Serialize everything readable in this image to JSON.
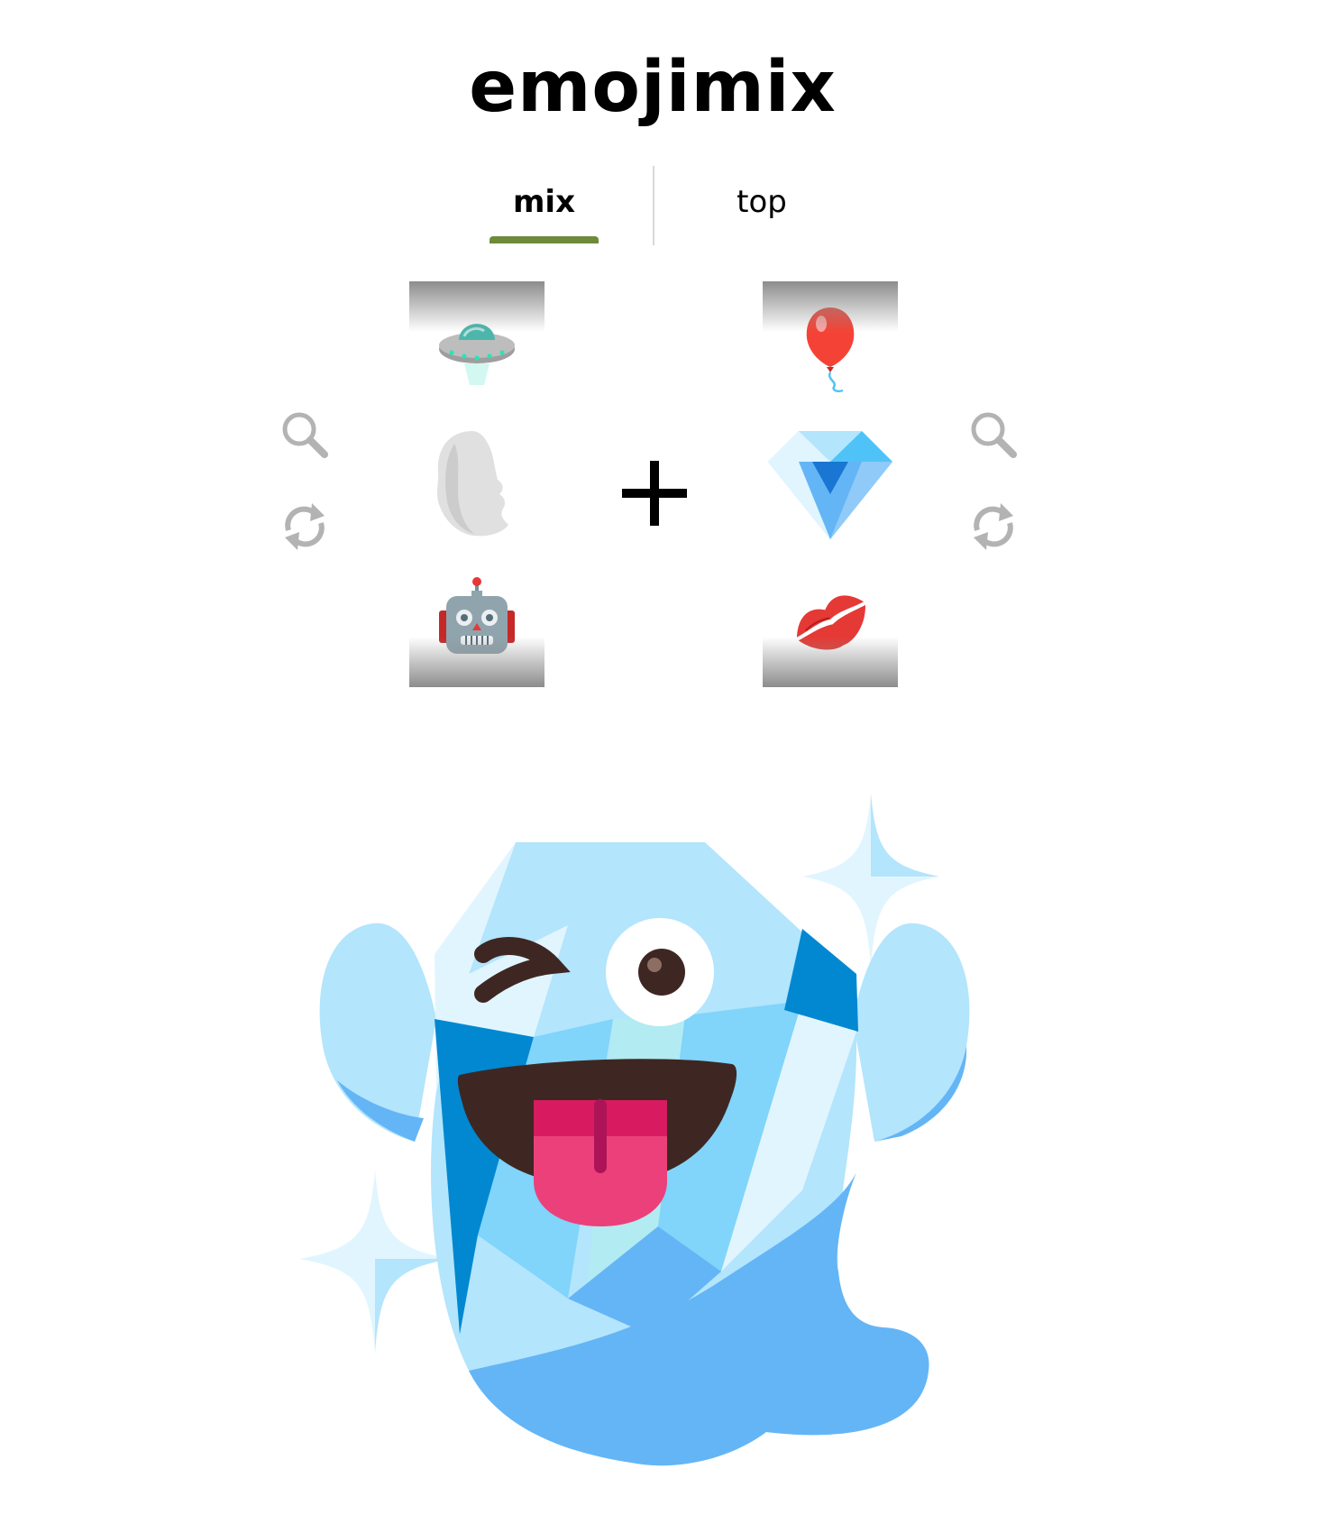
{
  "app": {
    "title": "emojimix"
  },
  "tabs": [
    {
      "label": "mix",
      "active": true
    },
    {
      "label": "top",
      "active": false
    }
  ],
  "accent_color": "#6e8a3a",
  "left_reel": {
    "items": [
      "flying-saucer",
      "silhouette-head",
      "robot"
    ],
    "selected_index": 1
  },
  "right_reel": {
    "items": [
      "balloon",
      "gem-stone",
      "kiss-mark"
    ],
    "selected_index": 1
  },
  "controls": {
    "search_icon": "magnifier-icon",
    "shuffle_icon": "refresh-icon",
    "operator_icon": "plus-icon"
  },
  "result": {
    "emoji": "diamond-ghost-winking-tongue",
    "colors": {
      "light_blue": "#b3e5fc",
      "mid_blue": "#81d4fa",
      "blue": "#64b5f6",
      "dark_blue": "#0288d1",
      "mouth": "#3e2723",
      "tongue": "#f06292"
    }
  }
}
